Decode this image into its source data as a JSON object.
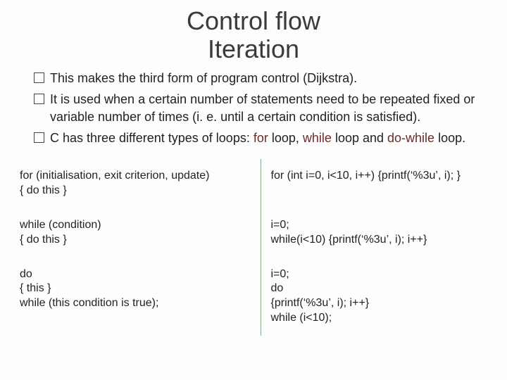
{
  "title": {
    "line1": "Control flow",
    "line2": "Iteration"
  },
  "bullets": {
    "b1": "This makes the third form of program control (Dijkstra).",
    "b2": "It is used when a certain number of statements need to be repeated fixed or variable number of times (i. e. until a certain condition is satisfied).",
    "b3_pre": "C has three different types of loops:  ",
    "b3_for": "for",
    "b3_mid1": " loop,  ",
    "b3_while": "while",
    "b3_mid2": " loop and ",
    "b3_do": "do-while",
    "b3_post": " loop."
  },
  "cells": {
    "r1l": "for (initialisation, exit criterion, update)\n{ do this }",
    "r1r": "for (int i=0, i<10, i++) {printf(‘%3u’, i); }",
    "r2l": "while (condition)\n{ do this }",
    "r2r": "i=0;\nwhile(i<10) {printf(‘%3u’, i); i++}",
    "r3l": "do\n{ this }\nwhile (this condition is true);",
    "r3r": "i=0;\ndo\n{printf(‘%3u’, i); i++}\nwhile (i<10);"
  }
}
